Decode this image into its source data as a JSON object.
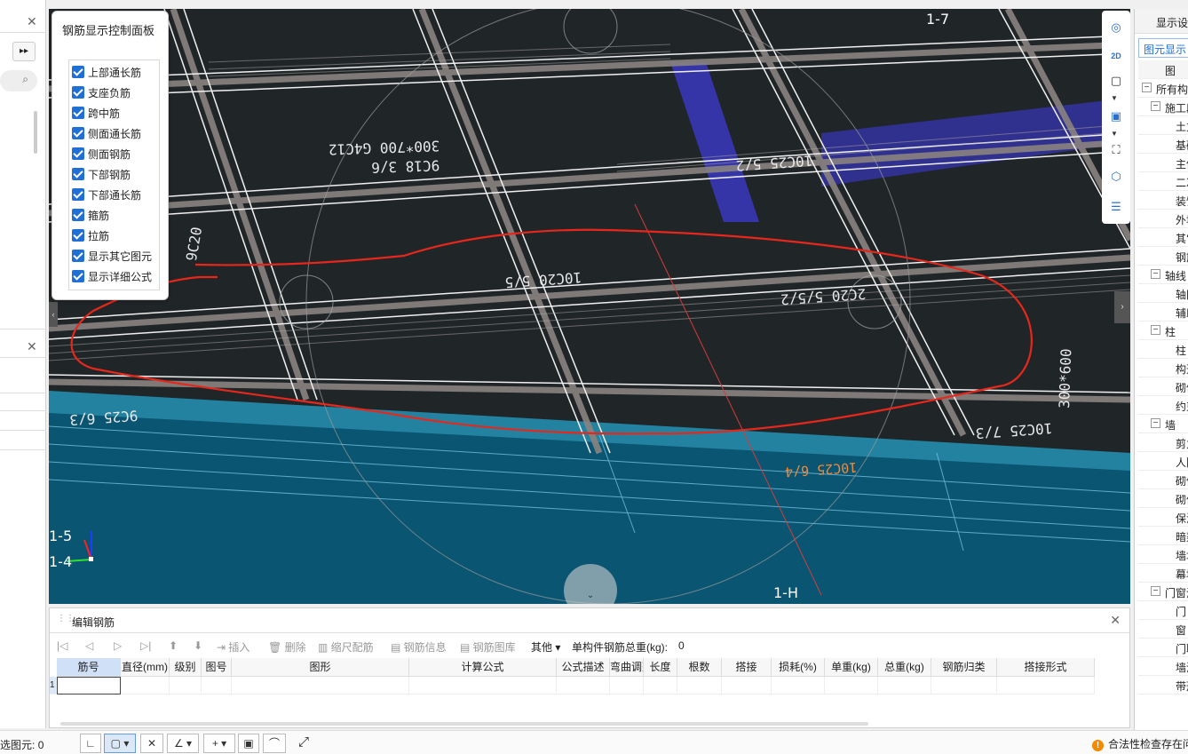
{
  "left_panel": {
    "expand_icon": "double-chevron-right",
    "close_icon": "close"
  },
  "rebar_panel": {
    "title": "钢筋显示控制面板",
    "options": [
      {
        "label": "上部通长筋",
        "checked": true
      },
      {
        "label": "支座负筋",
        "checked": true
      },
      {
        "label": "跨中筋",
        "checked": true
      },
      {
        "label": "侧面通长筋",
        "checked": true
      },
      {
        "label": "侧面钢筋",
        "checked": true
      },
      {
        "label": "下部钢筋",
        "checked": true
      },
      {
        "label": "下部通长筋",
        "checked": true
      },
      {
        "label": "箍筋",
        "checked": true
      },
      {
        "label": "拉筋",
        "checked": true
      },
      {
        "label": "显示其它图元",
        "checked": true
      },
      {
        "label": "显示详细公式",
        "checked": true
      }
    ]
  },
  "viewport": {
    "annotations": [
      "300*700 G4C12",
      "9C18 3/6",
      "10C20 5/5",
      "2C20 5/5/2",
      "10C25 5/2",
      "1-7",
      "1-5",
      "1-4",
      "1-H",
      "10C25 6/4",
      "10C25 7/3",
      "300*600",
      "9C25 6/3",
      "9C20"
    ],
    "axis_labels": {
      "a": "1-7",
      "b": "1-5",
      "c": "1-4",
      "d": "1-H"
    }
  },
  "right_toolbar": {
    "tools": [
      "orbit-icon",
      "2d-view-icon",
      "3d-box-icon",
      "3d-solid-icon",
      "fullscreen-icon",
      "cube-select-icon",
      "layer-settings-icon"
    ]
  },
  "right_panel": {
    "title": "显示设",
    "tab": "图元显示",
    "col_header": "图",
    "tree": [
      {
        "label": "所有构",
        "level": 0,
        "toggle": "−"
      },
      {
        "label": "施工段",
        "level": 1,
        "toggle": "−"
      },
      {
        "label": "土方",
        "level": 2
      },
      {
        "label": "基础",
        "level": 2
      },
      {
        "label": "主体",
        "level": 2
      },
      {
        "label": "二次",
        "level": 2
      },
      {
        "label": "装饰",
        "level": 2
      },
      {
        "label": "外墙",
        "level": 2
      },
      {
        "label": "其它",
        "level": 2
      },
      {
        "label": "钢筋",
        "level": 2
      },
      {
        "label": "轴线",
        "level": 1,
        "toggle": "−"
      },
      {
        "label": "轴网",
        "level": 2
      },
      {
        "label": "辅助",
        "level": 2
      },
      {
        "label": "柱",
        "level": 1,
        "toggle": "−"
      },
      {
        "label": "柱",
        "level": 2
      },
      {
        "label": "构造",
        "level": 2
      },
      {
        "label": "砌体",
        "level": 2
      },
      {
        "label": "约束",
        "level": 2
      },
      {
        "label": "墙",
        "level": 1,
        "toggle": "−"
      },
      {
        "label": "剪力",
        "level": 2
      },
      {
        "label": "人防",
        "level": 2
      },
      {
        "label": "砌体",
        "level": 2
      },
      {
        "label": "砌体",
        "level": 2
      },
      {
        "label": "保温",
        "level": 2
      },
      {
        "label": "暗梁",
        "level": 2
      },
      {
        "label": "墙垛",
        "level": 2
      },
      {
        "label": "幕墙",
        "level": 2
      },
      {
        "label": "门窗洞",
        "level": 1,
        "toggle": "−"
      },
      {
        "label": "门",
        "level": 2
      },
      {
        "label": "窗",
        "level": 2
      },
      {
        "label": "门联",
        "level": 2
      },
      {
        "label": "墙洞",
        "level": 2
      },
      {
        "label": "带形",
        "level": 2
      }
    ]
  },
  "edit_panel": {
    "title": "编辑钢筋",
    "toolbar": {
      "insert": "插入",
      "delete": "删除",
      "scale_rebar": "缩尺配筋",
      "rebar_info": "钢筋信息",
      "rebar_library": "钢筋图库",
      "other": "其他",
      "total_weight_label": "单构件钢筋总重(kg):",
      "total_weight_value": "0"
    },
    "columns": [
      "筋号",
      "直径(mm)",
      "级别",
      "图号",
      "图形",
      "计算公式",
      "公式描述",
      "弯曲调整",
      "长度",
      "根数",
      "搭接",
      "损耗(%)",
      "单重(kg)",
      "总重(kg)",
      "钢筋归类",
      "搭接形式"
    ],
    "row_number": "1"
  },
  "status_bar": {
    "selected_label": "选图元:",
    "selected_count": "0",
    "warning": "合法性检查存在问"
  }
}
